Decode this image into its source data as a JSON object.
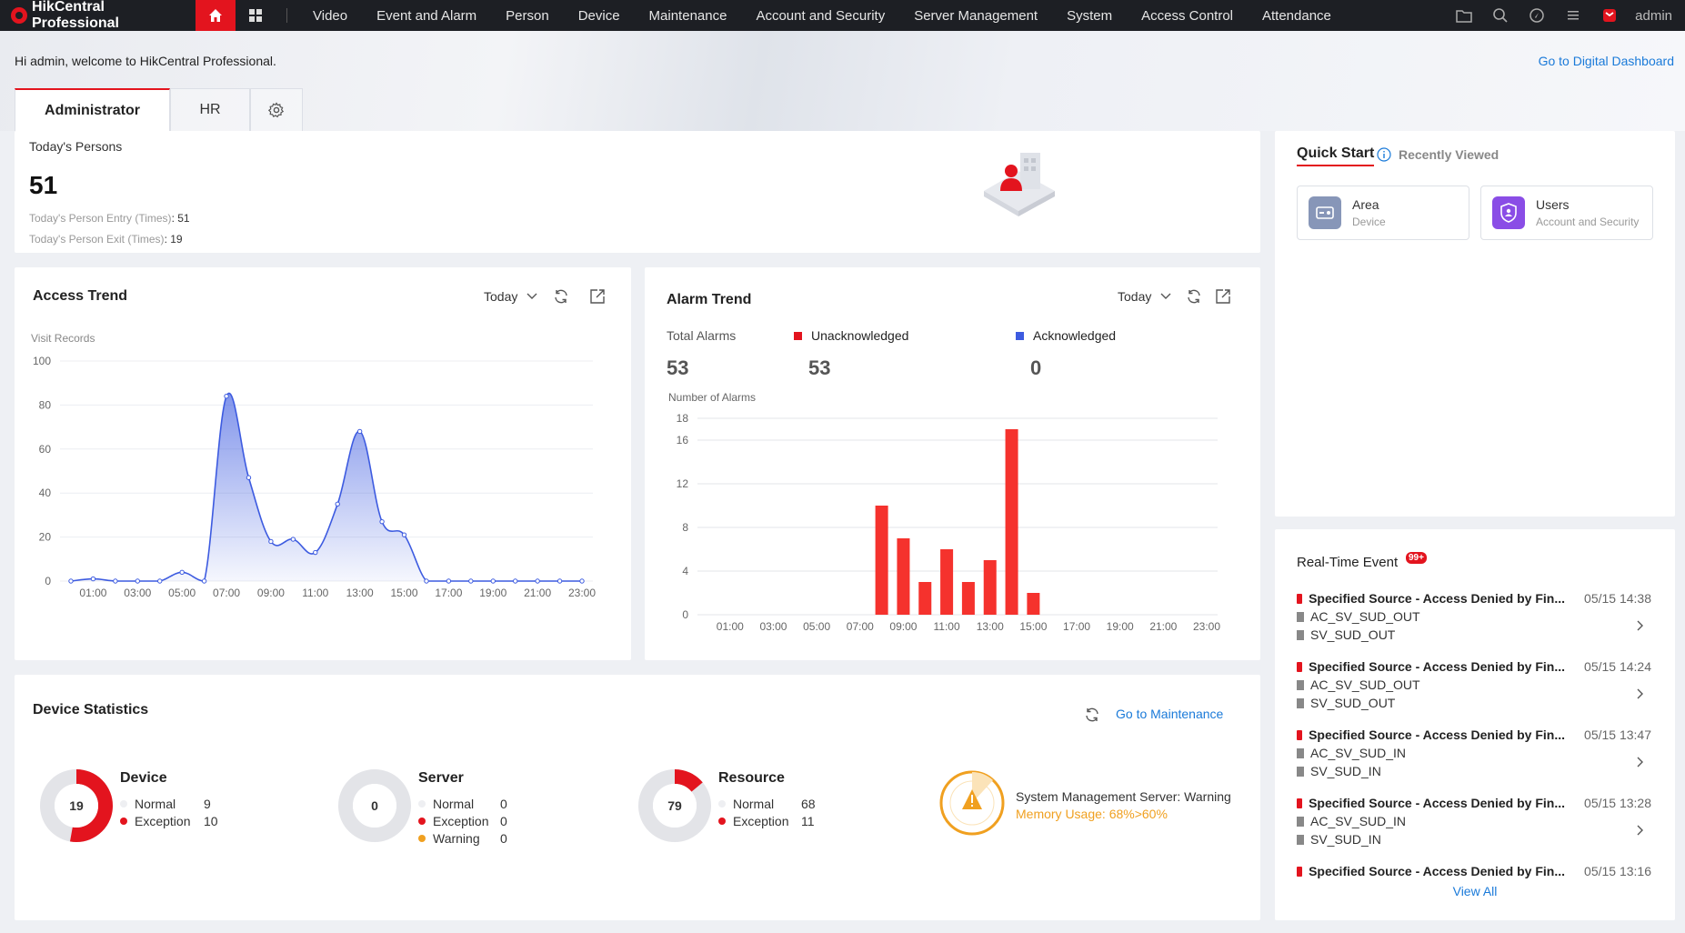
{
  "app": {
    "title": "HikCentral Professional"
  },
  "nav": {
    "items": [
      "Video",
      "Event and Alarm",
      "Person",
      "Device",
      "Maintenance",
      "Account and Security",
      "Server Management",
      "System",
      "Access Control",
      "Attendance"
    ],
    "user": "admin"
  },
  "welcome": {
    "text": "Hi admin, welcome to HikCentral Professional.",
    "dashboard_link": "Go to Digital Dashboard"
  },
  "tabs": [
    {
      "label": "Administrator"
    },
    {
      "label": "HR"
    }
  ],
  "persons": {
    "title": "Today's Persons",
    "count": "51",
    "entry_label": "Today's Person Entry (Times)",
    "entry_value": ": 51",
    "exit_label": "Today's Person Exit (Times)",
    "exit_value": ": 19"
  },
  "access_trend": {
    "title": "Access Trend",
    "period": "Today",
    "sublabel": "Visit Records"
  },
  "alarm_trend": {
    "title": "Alarm Trend",
    "period": "Today",
    "total_label": "Total Alarms",
    "total": "53",
    "unack_label": "Unacknowledged",
    "unack": "53",
    "ack_label": "Acknowledged",
    "ack": "0",
    "axis_label": "Number of Alarms"
  },
  "chart_data": [
    {
      "type": "area",
      "title": "Access Trend",
      "ylabel": "Visit Records",
      "x": [
        "00:00",
        "01:00",
        "02:00",
        "03:00",
        "04:00",
        "05:00",
        "06:00",
        "07:00",
        "08:00",
        "09:00",
        "10:00",
        "11:00",
        "12:00",
        "13:00",
        "14:00",
        "15:00",
        "16:00",
        "17:00",
        "18:00",
        "19:00",
        "20:00",
        "21:00",
        "22:00",
        "23:00"
      ],
      "tick_labels": [
        "01:00",
        "03:00",
        "05:00",
        "07:00",
        "09:00",
        "11:00",
        "13:00",
        "15:00",
        "17:00",
        "19:00",
        "21:00",
        "23:00"
      ],
      "values": [
        0,
        1,
        0,
        0,
        0,
        4,
        0,
        84,
        47,
        18,
        19,
        13,
        35,
        68,
        27,
        21,
        0,
        0,
        0,
        0,
        0,
        0,
        0,
        0
      ],
      "ylim": [
        0,
        100
      ],
      "yticks": [
        0,
        20,
        40,
        60,
        80,
        100
      ],
      "color": "#3d5be0"
    },
    {
      "type": "bar",
      "title": "Alarm Trend",
      "ylabel": "Number of Alarms",
      "x": [
        "00:00",
        "01:00",
        "02:00",
        "03:00",
        "04:00",
        "05:00",
        "06:00",
        "07:00",
        "08:00",
        "09:00",
        "10:00",
        "11:00",
        "12:00",
        "13:00",
        "14:00",
        "15:00",
        "16:00",
        "17:00",
        "18:00",
        "19:00",
        "20:00",
        "21:00",
        "22:00",
        "23:00"
      ],
      "tick_labels": [
        "01:00",
        "03:00",
        "05:00",
        "07:00",
        "09:00",
        "11:00",
        "13:00",
        "15:00",
        "17:00",
        "19:00",
        "21:00",
        "23:00"
      ],
      "values": [
        0,
        0,
        0,
        0,
        0,
        0,
        0,
        0,
        10,
        7,
        3,
        6,
        3,
        5,
        17,
        2,
        0,
        0,
        0,
        0,
        0,
        0,
        0,
        0
      ],
      "ylim": [
        0,
        18
      ],
      "yticks": [
        0,
        4,
        8,
        12,
        16,
        18
      ],
      "color": "#f5322d"
    }
  ],
  "device_stats": {
    "title": "Device Statistics",
    "maintenance_link": "Go to Maintenance",
    "device": {
      "label": "Device",
      "total": "19",
      "normal_label": "Normal",
      "normal": "9",
      "exception_label": "Exception",
      "exception": "10"
    },
    "server": {
      "label": "Server",
      "total": "0",
      "normal_label": "Normal",
      "normal": "0",
      "exception_label": "Exception",
      "exception": "0",
      "warning_label": "Warning",
      "warning": "0"
    },
    "resource": {
      "label": "Resource",
      "total": "79",
      "normal_label": "Normal",
      "normal": "68",
      "exception_label": "Exception",
      "exception": "11"
    },
    "warning": {
      "title": "System Management Server: Warning",
      "detail": "Memory Usage: 68%>60%"
    }
  },
  "quick_start": {
    "tab_active": "Quick Start",
    "tab_other": "Recently Viewed",
    "items": [
      {
        "title": "Area",
        "subtitle": "Device"
      },
      {
        "title": "Users",
        "subtitle": "Account and Security"
      }
    ]
  },
  "realtime": {
    "title": "Real-Time Event",
    "badge": "99+",
    "view_all": "View All",
    "events": [
      {
        "title": "Specified Source - Access Denied by Fin...",
        "time": "05/15 14:38",
        "line1": "AC_SV_SUD_OUT",
        "line2": "SV_SUD_OUT"
      },
      {
        "title": "Specified Source - Access Denied by Fin...",
        "time": "05/15 14:24",
        "line1": "AC_SV_SUD_OUT",
        "line2": "SV_SUD_OUT"
      },
      {
        "title": "Specified Source - Access Denied by Fin...",
        "time": "05/15 13:47",
        "line1": "AC_SV_SUD_IN",
        "line2": "SV_SUD_IN"
      },
      {
        "title": "Specified Source - Access Denied by Fin...",
        "time": "05/15 13:28",
        "line1": "AC_SV_SUD_IN",
        "line2": "SV_SUD_IN"
      },
      {
        "title": "Specified Source - Access Denied by Fin...",
        "time": "05/15 13:16"
      }
    ]
  },
  "colors": {
    "brand": "#e3141e",
    "link": "#1a7ad9",
    "line": "#3d5be0",
    "bar": "#f5322d",
    "warning": "#f0a020",
    "acknowledged": "#3d5be0"
  }
}
